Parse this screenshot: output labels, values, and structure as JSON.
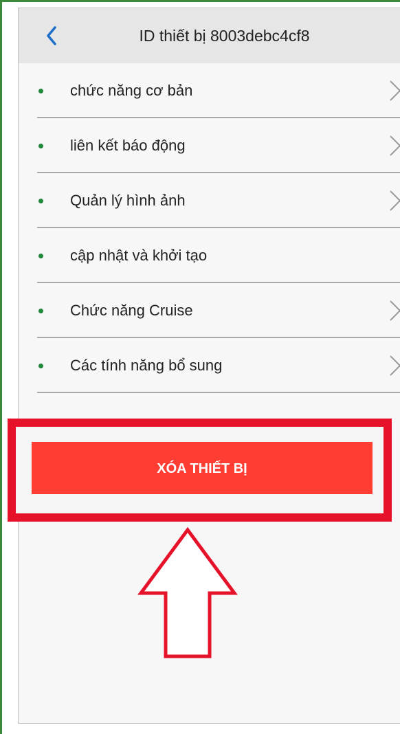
{
  "header": {
    "title": "ID thiết bị  8003debc4cf8",
    "back_icon": "chevron-left-icon"
  },
  "menu": {
    "items": [
      {
        "label": "chức năng cơ bản",
        "has_chevron": true
      },
      {
        "label": "liên kết báo động",
        "has_chevron": true
      },
      {
        "label": "Quản lý hình ảnh",
        "has_chevron": true
      },
      {
        "label": "cập nhật và khởi tạo",
        "has_chevron": false
      },
      {
        "label": "Chức năng Cruise",
        "has_chevron": true
      },
      {
        "label": "Các tính năng bổ sung",
        "has_chevron": true
      }
    ]
  },
  "actions": {
    "delete_label": "XÓA THIẾT BỊ"
  },
  "colors": {
    "accent_blue": "#1e6fc8",
    "bullet_green": "#1f8a3c",
    "delete_red": "#ff3d33",
    "highlight_red": "#e5122a"
  }
}
